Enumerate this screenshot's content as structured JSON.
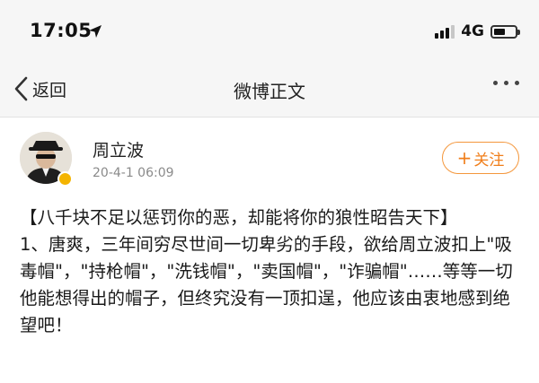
{
  "status_bar": {
    "time": "17:05",
    "network": "4G"
  },
  "nav": {
    "back_label": "返回",
    "title": "微博正文"
  },
  "post": {
    "author_name": "周立波",
    "date": "20-4-1 06:09",
    "follow_label": "关注",
    "title_line": "【八千块不足以惩罚你的恶，却能将你的狼性昭告天下】",
    "body_line": "1、唐爽，三年间穷尽世间一切卑劣的手段，欲给周立波扣上\"吸毒帽\"，\"持枪帽\"，\"洗钱帽\"，\"卖国帽\"，\"诈骗帽\"……等等一切他能想得出的帽子，但终究没有一顶扣逞，他应该由衷地感到绝望吧！"
  },
  "colors": {
    "accent": "#f07e1a",
    "verified": "#f4b400"
  }
}
